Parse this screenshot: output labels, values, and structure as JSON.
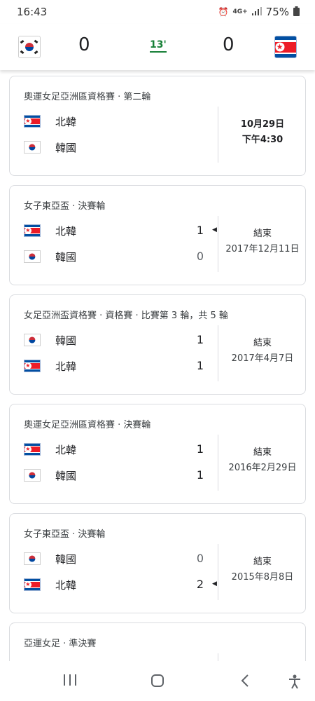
{
  "status_bar": {
    "time": "16:43",
    "network": "4G+",
    "battery": "75%",
    "icons": [
      "alarm-icon",
      "network-icon",
      "signal-icon",
      "battery-icon"
    ]
  },
  "header": {
    "left_team_flag": "south-korea-flag",
    "left_score": "0",
    "minute": "13'",
    "right_score": "0",
    "right_team_flag": "north-korea-flag",
    "minute_color": "#188038"
  },
  "matches": [
    {
      "competition": "奧運女足亞洲區資格賽 · 第二輪",
      "teams": [
        {
          "name": "北韓",
          "flag": "north-korea-flag",
          "score": ""
        },
        {
          "name": "韓國",
          "flag": "south-korea-flag",
          "score": ""
        }
      ],
      "status": "10月29日",
      "date": "下午4:30"
    },
    {
      "competition": "女子東亞盃 · 決賽輪",
      "teams": [
        {
          "name": "北韓",
          "flag": "north-korea-flag",
          "score": "1"
        },
        {
          "name": "韓國",
          "flag": "south-korea-flag",
          "score": "0"
        }
      ],
      "status": "結束",
      "date": "2017年12月11日"
    },
    {
      "competition": "女足亞洲盃資格賽 · 資格賽 · 比賽第 3 輪，共 5 輪",
      "teams": [
        {
          "name": "韓國",
          "flag": "south-korea-flag",
          "score": "1"
        },
        {
          "name": "北韓",
          "flag": "north-korea-flag",
          "score": "1"
        }
      ],
      "status": "結束",
      "date": "2017年4月7日"
    },
    {
      "competition": "奧運女足亞洲區資格賽 · 決賽輪",
      "teams": [
        {
          "name": "北韓",
          "flag": "north-korea-flag",
          "score": "1"
        },
        {
          "name": "韓國",
          "flag": "south-korea-flag",
          "score": "1"
        }
      ],
      "status": "結束",
      "date": "2016年2月29日"
    },
    {
      "competition": "女子東亞盃 · 決賽輪",
      "teams": [
        {
          "name": "韓國",
          "flag": "south-korea-flag",
          "score": "0"
        },
        {
          "name": "北韓",
          "flag": "north-korea-flag",
          "score": "2"
        }
      ],
      "status": "結束",
      "date": "2015年8月8日"
    },
    {
      "competition": "亞運女足 · 準決賽"
    }
  ],
  "nav_bar": {
    "icons": [
      "recent-apps-icon",
      "home-icon",
      "back-icon",
      "accessibility-icon"
    ]
  }
}
